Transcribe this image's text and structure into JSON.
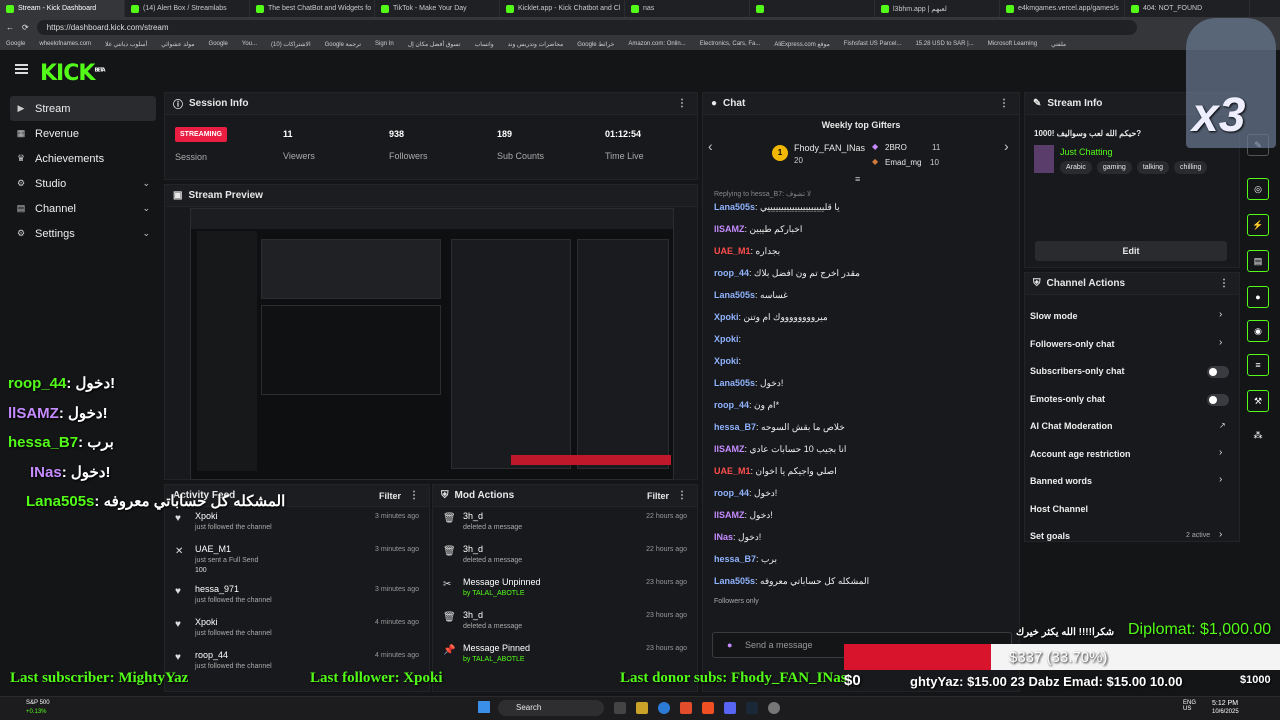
{
  "browser": {
    "tabs": [
      "Stream - Kick Dashboard",
      "(14) Alert Box / Streamlabs",
      "The best ChatBot and Widgets fo",
      "TikTok - Make Your Day",
      "Kicklet.app - Kick Chatbot and Cl",
      "nas",
      "",
      "l3bhm.app | لعبهم",
      "e4kmgames.vercel.app/games/s",
      "404: NOT_FOUND"
    ],
    "url": "https://dashboard.kick.com/stream",
    "bookmarks": [
      "Google",
      "wheelofnames.com",
      "أسلوب ديانتي غلا",
      "مولد عشوائي",
      "Google",
      "You...",
      "(10) الاشتراكات",
      "Google ترجمة",
      "Sign In",
      "تسوق أفضل مكان إل",
      "واتساب",
      "محاضرات وتدريس وند",
      "Google خرائط",
      "Amazon.com: Onlin...",
      "Electronics, Cars, Fa...",
      "AliExpress.com موقع",
      "Fishsfast US Parcel...",
      "15.28 USD to SAR |...",
      "Microsoft Learning",
      "ملفتي"
    ]
  },
  "app": {
    "logo": "KICK",
    "logo_sup": "BETA"
  },
  "sidebar": [
    {
      "label": "Stream",
      "icon": "stream-icon"
    },
    {
      "label": "Revenue",
      "icon": "revenue-icon"
    },
    {
      "label": "Achievements",
      "icon": "trophy-icon"
    },
    {
      "label": "Studio",
      "icon": "studio-icon"
    },
    {
      "label": "Channel",
      "icon": "channel-icon"
    },
    {
      "label": "Settings",
      "icon": "gear-icon"
    }
  ],
  "session": {
    "title": "Session Info",
    "badge": "STREAMING",
    "badge_label": "Session",
    "stats": [
      {
        "v": "11",
        "l": "Viewers"
      },
      {
        "v": "938",
        "l": "Followers"
      },
      {
        "v": "189",
        "l": "Sub Counts"
      },
      {
        "v": "01:12:54",
        "l": "Time Live"
      }
    ]
  },
  "preview": {
    "title": "Stream Preview"
  },
  "activity": {
    "title": "Activity Feed",
    "filter": "Filter",
    "items": [
      {
        "n": "Xpoki",
        "d": "just followed the channel",
        "t": "3 minutes ago"
      },
      {
        "n": "UAE_M1",
        "d": "just sent a Full Send",
        "extra": "100",
        "t": "3 minutes ago"
      },
      {
        "n": "hessa_971",
        "d": "just followed the channel",
        "t": "3 minutes ago"
      },
      {
        "n": "Xpoki",
        "d": "just followed the channel",
        "t": "4 minutes ago"
      },
      {
        "n": "roop_44",
        "d": "just followed the channel",
        "t": "4 minutes ago"
      }
    ]
  },
  "mod": {
    "title": "Mod Actions",
    "filter": "Filter",
    "items": [
      {
        "n": "3h_d",
        "d": "deleted a message",
        "t": "22 hours ago"
      },
      {
        "n": "3h_d",
        "d": "deleted a message",
        "t": "22 hours ago"
      },
      {
        "n": "Message Unpinned",
        "d": "by TALAL_ABOTLE",
        "t": "23 hours ago"
      },
      {
        "n": "3h_d",
        "d": "deleted a message",
        "t": "23 hours ago"
      },
      {
        "n": "Message Pinned",
        "d": "by TALAL_ABOTLE",
        "t": "23 hours ago"
      }
    ]
  },
  "chat": {
    "title": "Chat",
    "gifters_title": "Weekly top Gifters",
    "top": {
      "name": "Fhody_FAN_INas",
      "count": "20"
    },
    "second": {
      "name": "2BRO",
      "count": "11"
    },
    "third": {
      "name": "Emad_mg",
      "count": "10"
    },
    "replying": "Replying to hessa_B7: لا تشوف",
    "lines": [
      {
        "u": "Lana505s",
        "m": "يا قليييييييييييييييييييييي",
        "c": "#8fb3ff"
      },
      {
        "u": "llSAMZ",
        "m": "اخباركم طيبين",
        "c": "#c58bff"
      },
      {
        "u": "UAE_M1",
        "m": "بجداره",
        "c": "#ff4d4d"
      },
      {
        "u": "roop_44",
        "m": "مقدر اخرج تم ون افضل بلاك",
        "c": "#8fb3ff"
      },
      {
        "u": "Lana505s",
        "m": "غساسه",
        "c": "#8fb3ff"
      },
      {
        "u": "Xpoki",
        "m": "ميرووووووووك ام وتنن",
        "c": "#8fb3ff"
      },
      {
        "u": "Xpoki",
        "m": "",
        "c": "#8fb3ff"
      },
      {
        "u": "Xpoki",
        "m": "",
        "c": "#8fb3ff"
      },
      {
        "u": "Lana505s",
        "m": "دخول!",
        "c": "#8fb3ff"
      },
      {
        "u": "roop_44",
        "m": "ام ون*",
        "c": "#8fb3ff"
      },
      {
        "u": "hessa_B7",
        "m": "خلاص ما بقش السوحه",
        "c": "#8fb3ff"
      },
      {
        "u": "llSAMZ",
        "m": "انا بجيب 10 حسابات عادي",
        "c": "#c58bff"
      },
      {
        "u": "UAE_M1",
        "m": "اصلي واجيكم يا اخوان",
        "c": "#ff4d4d"
      },
      {
        "u": "roop_44",
        "m": "دخول!",
        "c": "#8fb3ff"
      },
      {
        "u": "llSAMZ",
        "m": "دخول!",
        "c": "#c58bff"
      },
      {
        "u": "INas",
        "m": "دخول!",
        "c": "#c58bff"
      },
      {
        "u": "hessa_B7",
        "m": "برب",
        "c": "#8fb3ff"
      },
      {
        "u": "Lana505s",
        "m": "المشكله كل حساباتي معروفه",
        "c": "#8fb3ff"
      }
    ],
    "followers_only": "Followers only",
    "placeholder": "Send a message"
  },
  "streaminfo": {
    "title": "Stream Info",
    "stream_title": "حيكم الله لعب وسواليف !1000?",
    "category": "Just Chatting",
    "tags": [
      "Arabic",
      "gaming",
      "talking",
      "chilling"
    ],
    "edit": "Edit"
  },
  "chanactions": {
    "title": "Channel Actions",
    "rows": [
      {
        "l": "Slow mode",
        "k": "chev"
      },
      {
        "l": "Followers-only chat",
        "k": "chev"
      },
      {
        "l": "Subscribers-only chat",
        "k": "toggle"
      },
      {
        "l": "Emotes-only chat",
        "k": "toggle"
      },
      {
        "l": "AI Chat Moderation",
        "k": "ext"
      },
      {
        "l": "Account age restriction",
        "k": "chev"
      },
      {
        "l": "Banned words",
        "k": "chev"
      },
      {
        "l": "Host Channel",
        "k": "none"
      },
      {
        "l": "Set goals",
        "k": "chev",
        "badge": "2 active"
      }
    ]
  },
  "overlay": {
    "names": [
      {
        "u": "roop_44",
        "m": ": دخول!"
      },
      {
        "u": "llSAMZ",
        "m": ": دخول!"
      },
      {
        "u": "hessa_B7",
        "m": ": برب"
      },
      {
        "u": "INas",
        "m": ": دخول!"
      },
      {
        "u": "Lana505s",
        "m": ": المشكله كل حساباتي معروفه"
      }
    ],
    "last_sub": "Last subscriber: MightyYaz",
    "last_follower": "Last follower: Xpoki",
    "last_donor": "Last donor subs: Fhody_FAN_INas",
    "diplomat": "Diplomat: $1,000.00",
    "goal": "$337 (33.70%)",
    "goal_progress": 0.337,
    "zero": "$0",
    "ticker": "ghtyYaz: $15.00  23  Dabz Emad: $15.00  10.00",
    "thanks": "شكرا!!!! الله يكثر خيرك",
    "max": "$1000",
    "x3": "x3"
  },
  "taskbar": {
    "search": "Search",
    "time": "5:12 PM",
    "date": "10/6/2025",
    "lang": "ENG US",
    "stock": "S&P 500",
    "stock_change": "+0.13%"
  }
}
